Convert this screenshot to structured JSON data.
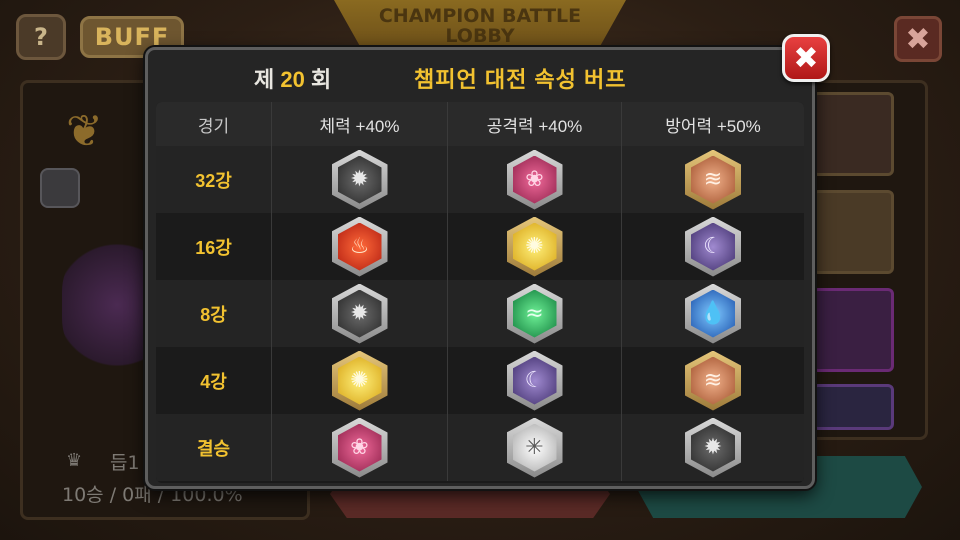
{
  "background": {
    "help_label": "?",
    "buff_label": "BUFF",
    "lobby_title_line1": "CHAMPION BATTLE",
    "lobby_title_line2": "LOBBY",
    "close_label": "✖",
    "player_stat_line1": "듭1",
    "player_stat_line2": "10승 / 0패 / 100.0%"
  },
  "modal": {
    "round_prefix": "제",
    "round_number": "20",
    "round_suffix": "회",
    "title": "챔피언 대전 속성 버프",
    "close_label": "✖",
    "columns": [
      "경기",
      "체력 +40%",
      "공격력 +40%",
      "방어력 +50%"
    ],
    "rows": [
      {
        "stage": "32강",
        "icons": [
          "dark-element-icon",
          "pink-element-icon",
          "earth-element-icon"
        ]
      },
      {
        "stage": "16강",
        "icons": [
          "fire-element-icon",
          "light-element-icon",
          "purple-element-icon"
        ]
      },
      {
        "stage": "8강",
        "icons": [
          "dark-element-icon",
          "wind-element-icon",
          "water-element-icon"
        ]
      },
      {
        "stage": "4강",
        "icons": [
          "light-element-icon",
          "purple-element-icon",
          "earth-element-icon"
        ]
      },
      {
        "stage": "결승",
        "icons": [
          "pink-element-icon",
          "white-element-icon",
          "dark-element-icon"
        ]
      }
    ]
  },
  "colors": {
    "accent_gold": "#f2c230",
    "close_red": "#d42a2a",
    "panel_bg": "#252525"
  }
}
